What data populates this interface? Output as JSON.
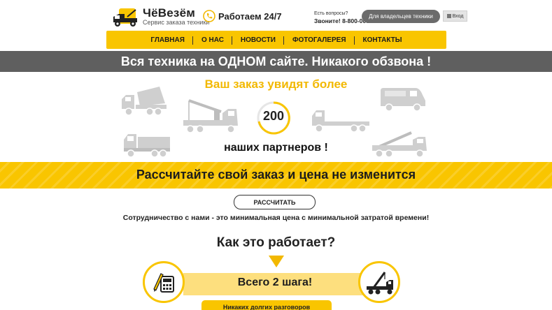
{
  "brand": {
    "name": "ЧёВезём",
    "tagline": "Сервис заказа техники"
  },
  "header": {
    "work_hours": "Работаем 24/7",
    "questions": "Есть вопросы?",
    "call": "Звоните! 8-800-000-00-00",
    "owners_button": "Для владельцев техники",
    "login_button": "Вход"
  },
  "nav": {
    "items": [
      "ГЛАВНАЯ",
      "О НАС",
      "НОВОСТИ",
      "ФОТОГАЛЕРЕЯ",
      "КОНТАКТЫ"
    ]
  },
  "hero": {
    "banner": "Вся техника на ОДНОМ сайте. Никакого обзвона !"
  },
  "partners": {
    "title": "Ваш заказ увидят более",
    "count": "200",
    "subtitle": "наших партнеров !"
  },
  "calc": {
    "banner": "Рассчитайте свой заказ и цена не изменится",
    "button": "РАССЧИТАТЬ",
    "note": "Сотрудничество с нами - это минимальная цена с минимальной затратой времени!"
  },
  "how": {
    "title": "Как это работает?",
    "steps_label": "Всего 2 шага!",
    "bottom_label": "Никаких долгих разговоров"
  },
  "colors": {
    "accent": "#f9c500",
    "dark_banner": "#5f5f5f",
    "truck_grey": "#cfcfcf"
  }
}
